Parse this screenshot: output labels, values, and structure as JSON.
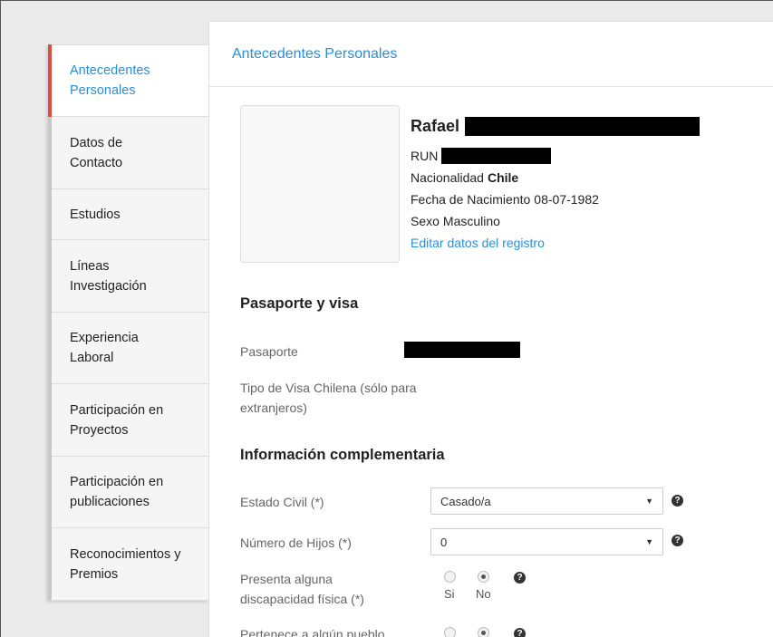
{
  "sidebar": {
    "items": [
      {
        "label": "Antecedentes Personales",
        "active": true
      },
      {
        "label": "Datos de Contacto"
      },
      {
        "label": "Estudios"
      },
      {
        "label": "Líneas Investigación"
      },
      {
        "label": "Experiencia Laboral"
      },
      {
        "label": "Participación en Proyectos"
      },
      {
        "label": "Participación en publicaciones"
      },
      {
        "label": "Reconocimientos y Premios"
      }
    ]
  },
  "panel": {
    "title": "Antecedentes Personales"
  },
  "profile": {
    "first_name": "Rafael",
    "run_label": "RUN",
    "nationality_label": "Nacionalidad",
    "nationality_value": "Chile",
    "birth_label": "Fecha de Nacimiento",
    "birth_value": "08-07-1982",
    "sex_label": "Sexo",
    "sex_value": "Masculino",
    "edit_link": "Editar datos del registro"
  },
  "passport_section": {
    "title": "Pasaporte y visa",
    "passport_label": "Pasaporte",
    "visa_label": "Tipo de Visa Chilena (sólo para extranjeros)"
  },
  "complementary_section": {
    "title": "Información complementaria",
    "civil_status_label": "Estado Civil (*)",
    "civil_status_value": "Casado/a",
    "children_label": "Número de Hijos (*)",
    "children_value": "0",
    "disability_label": "Presenta alguna discapacidad física (*)",
    "option_yes": "Si",
    "option_no": "No",
    "indigenous_label": "Pertenece a algún pueblo"
  },
  "icons": {
    "help": "question-circle-icon",
    "caret": "caret-down-icon"
  }
}
